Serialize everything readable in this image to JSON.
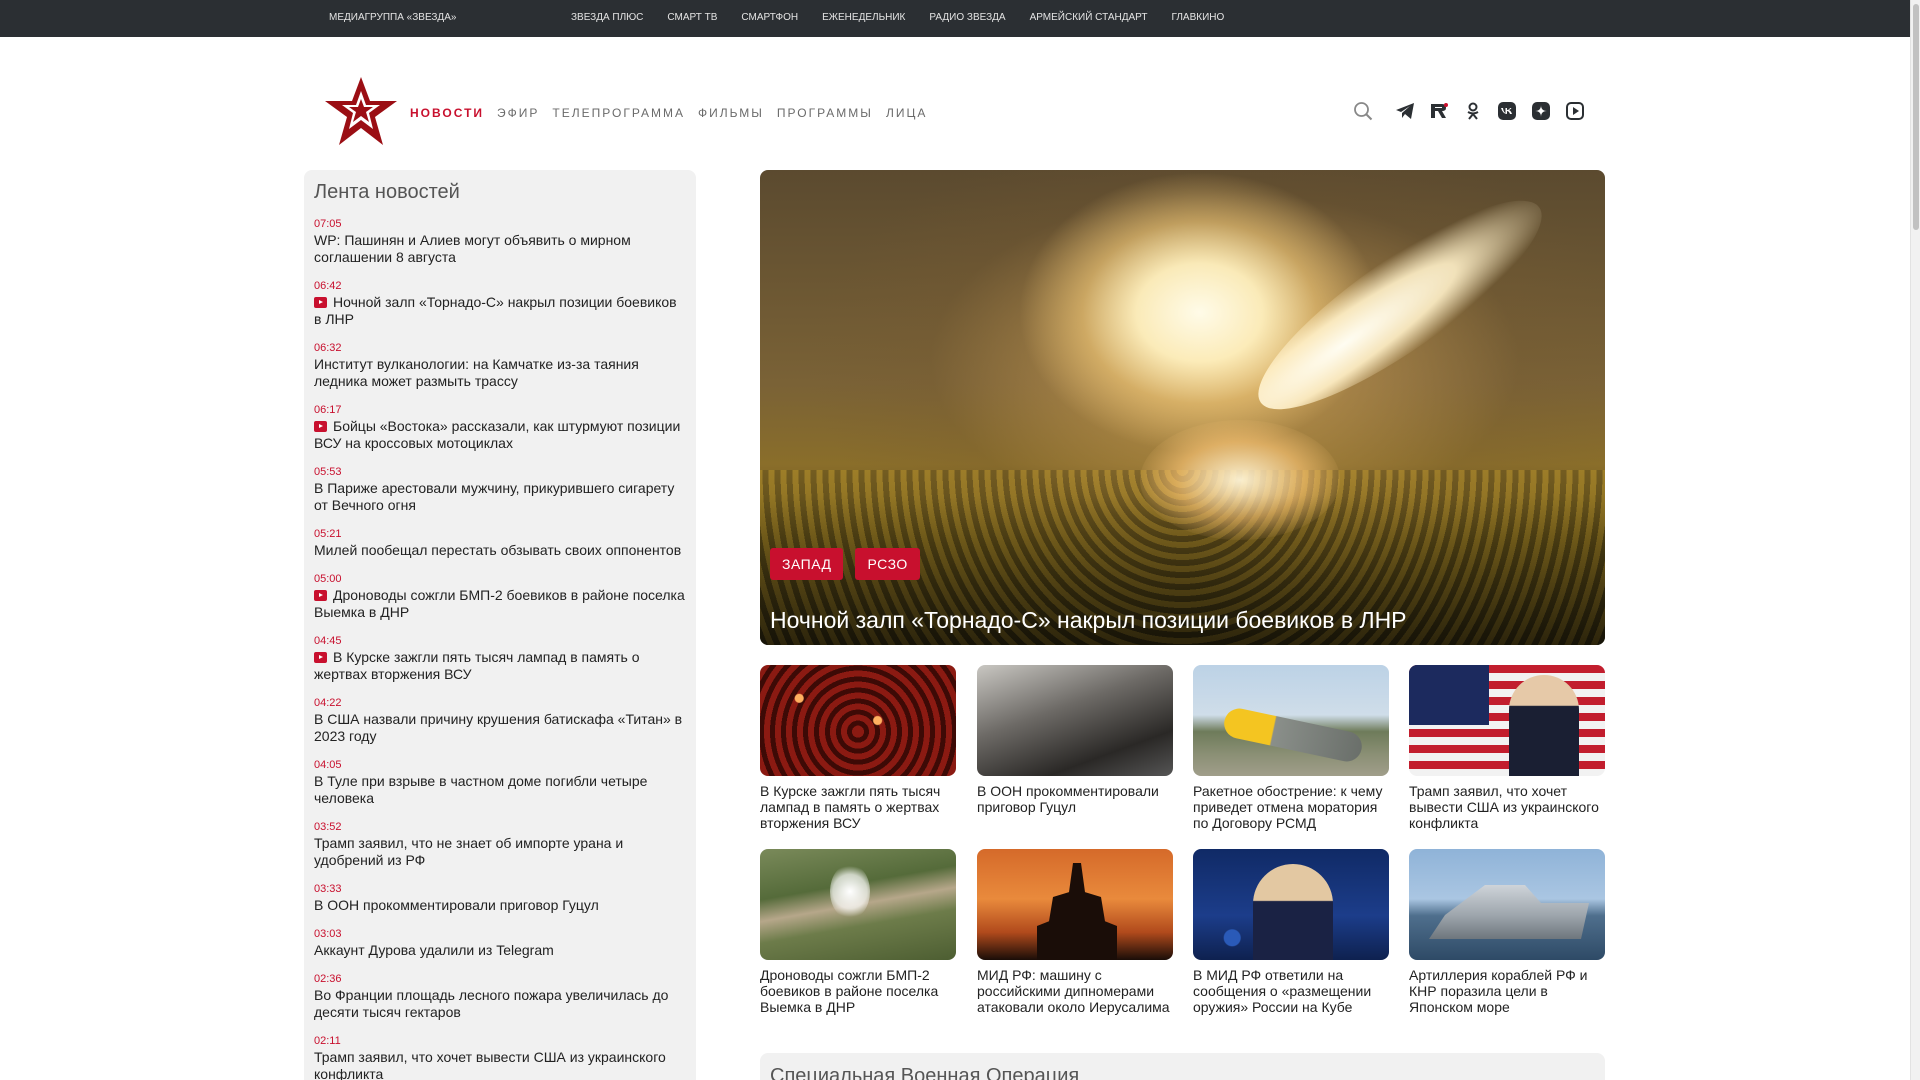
{
  "topbar": {
    "brand": "МЕДИАГРУППА «ЗВЕЗДА»",
    "links": [
      "ЗВЕЗДА ПЛЮС",
      "СМАРТ ТВ",
      "СМАРТФОН",
      "ЕЖЕНЕДЕЛЬНИК",
      "РАДИО ЗВЕЗДА",
      "АРМЕЙСКИЙ СТАНДАРТ",
      "ГЛАВКИНО"
    ]
  },
  "nav": {
    "items": [
      "НОВОСТИ",
      "ЭФИР",
      "ТЕЛЕПРОГРАММА",
      "ФИЛЬМЫ",
      "ПРОГРАММЫ",
      "ЛИЦА"
    ],
    "active_index": 0
  },
  "socials": [
    "search-icon",
    "telegram-icon",
    "rutube-icon",
    "odnoklassniki-icon",
    "vk-icon",
    "dzen-icon",
    "video-icon"
  ],
  "colors": {
    "accent": "#c8102e",
    "topbar": "#2b2f33",
    "panel": "#f1f1f1"
  },
  "feed": {
    "title": "Лента новостей",
    "items": [
      {
        "time": "07:05",
        "title": "WP: Пашинян и Алиев могут объявить о мирном соглашении 8 августа",
        "video": false
      },
      {
        "time": "06:42",
        "title": "Ночной залп «Торнадо-С» накрыл позиции боевиков в ЛНР",
        "video": true
      },
      {
        "time": "06:32",
        "title": "Институт вулканологии: на Камчатке из-за таяния ледника может размыть трассу",
        "video": false
      },
      {
        "time": "06:17",
        "title": "Бойцы «Востока» рассказали, как штурмуют позиции ВСУ на кроссовых мотоциклах",
        "video": true
      },
      {
        "time": "05:53",
        "title": "В Париже арестовали мужчину, прикурившего сигарету от Вечного огня",
        "video": false
      },
      {
        "time": "05:21",
        "title": "Милей пообещал перестать обзывать своих оппонентов",
        "video": false
      },
      {
        "time": "05:00",
        "title": "Дроноводы сожгли БМП-2 боевиков в районе поселка Выемка в ДНР",
        "video": true
      },
      {
        "time": "04:45",
        "title": "В Курске зажгли пять тысяч лампад в память о жертвах вторжения ВСУ",
        "video": true
      },
      {
        "time": "04:22",
        "title": "В США назвали причину крушения батискафа «Титан» в 2023 году",
        "video": false
      },
      {
        "time": "04:05",
        "title": "В Туле при взрыве в частном доме погибли четыре человека",
        "video": false
      },
      {
        "time": "03:52",
        "title": "Трамп заявил, что не знает об импорте урана и удобрений из РФ",
        "video": false
      },
      {
        "time": "03:33",
        "title": "В ООН прокомментировали приговор Гуцул",
        "video": false
      },
      {
        "time": "03:03",
        "title": "Аккаунт Дурова удалили из Telegram",
        "video": false
      },
      {
        "time": "02:36",
        "title": "Во Франции площадь лесного пожара увеличилась до десяти тысяч гектаров",
        "video": false
      },
      {
        "time": "02:11",
        "title": "Трамп заявил, что хочет вывести США из украинского конфликта",
        "video": false
      }
    ]
  },
  "hero": {
    "tags": [
      "ЗАПАД",
      "РСЗО"
    ],
    "title": "Ночной залп «Торнадо-С» накрыл позиции боевиков в ЛНР"
  },
  "cards": [
    {
      "title": "В Курске зажгли пять тысяч лампад в память о жертвах вторжения ВСУ",
      "image": "candles"
    },
    {
      "title": "В ООН прокомментировали приговор Гуцул",
      "image": "crowd"
    },
    {
      "title": "Ракетное обострение: к чему приведет отмена моратория по Договору РСМД",
      "image": "missile"
    },
    {
      "title": "Трамп заявил, что хочет вывести США из украинского конфликта",
      "image": "trump"
    },
    {
      "title": "Дроноводы сожгли БМП-2 боевиков в районе поселка Выемка в ДНР",
      "image": "aerial"
    },
    {
      "title": "МИД РФ: машину с российскими дипномерами атаковали около Иерусалима",
      "image": "sunset"
    },
    {
      "title": "В МИД РФ ответили на сообщения о «размещении оружия» России на Кубе",
      "image": "zakharova"
    },
    {
      "title": "Артиллерия кораблей РФ и КНР поразила цели в Японском море",
      "image": "ship"
    }
  ],
  "special": {
    "title": "Специальная Военная Операция"
  }
}
